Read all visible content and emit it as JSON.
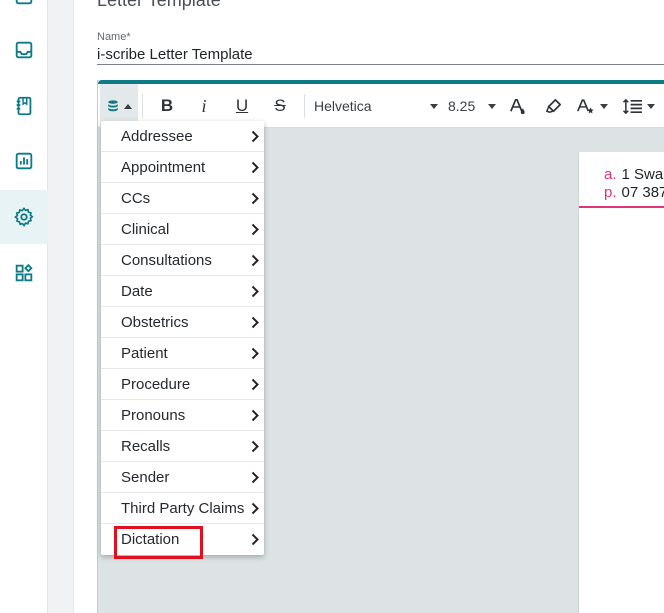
{
  "rail": {
    "items": [
      {
        "icon": "inbox-icon",
        "active": false
      },
      {
        "icon": "notebook-icon",
        "active": false
      },
      {
        "icon": "bar-chart-icon",
        "active": false
      },
      {
        "icon": "gear-icon",
        "active": true
      },
      {
        "icon": "widgets-icon",
        "active": false
      }
    ],
    "accent": "#0d7a86"
  },
  "page": {
    "heading": "Letter Template"
  },
  "form": {
    "name_label": "Name*",
    "name_value": "i-scribe Letter Template"
  },
  "toolbar": {
    "database_icon": "database-icon",
    "bold_label": "B",
    "italic_label": "i",
    "underline_label": "U",
    "strike_label": "S",
    "font_family": "Helvetica",
    "font_size": "8.25"
  },
  "document": {
    "address_key": "a.",
    "address_value": "1 Swa",
    "phone_key": "p.",
    "phone_value": "07 387",
    "accent": "#e0337a"
  },
  "menu": {
    "items": [
      {
        "label": "Addressee"
      },
      {
        "label": "Appointment"
      },
      {
        "label": "CCs"
      },
      {
        "label": "Clinical"
      },
      {
        "label": "Consultations"
      },
      {
        "label": "Date"
      },
      {
        "label": "Obstetrics"
      },
      {
        "label": "Patient"
      },
      {
        "label": "Procedure"
      },
      {
        "label": "Pronouns"
      },
      {
        "label": "Recalls"
      },
      {
        "label": "Sender"
      },
      {
        "label": "Third Party Claims"
      },
      {
        "label": "Dictation"
      }
    ],
    "highlighted": "Dictation",
    "highlight_color": "#e0101f"
  }
}
